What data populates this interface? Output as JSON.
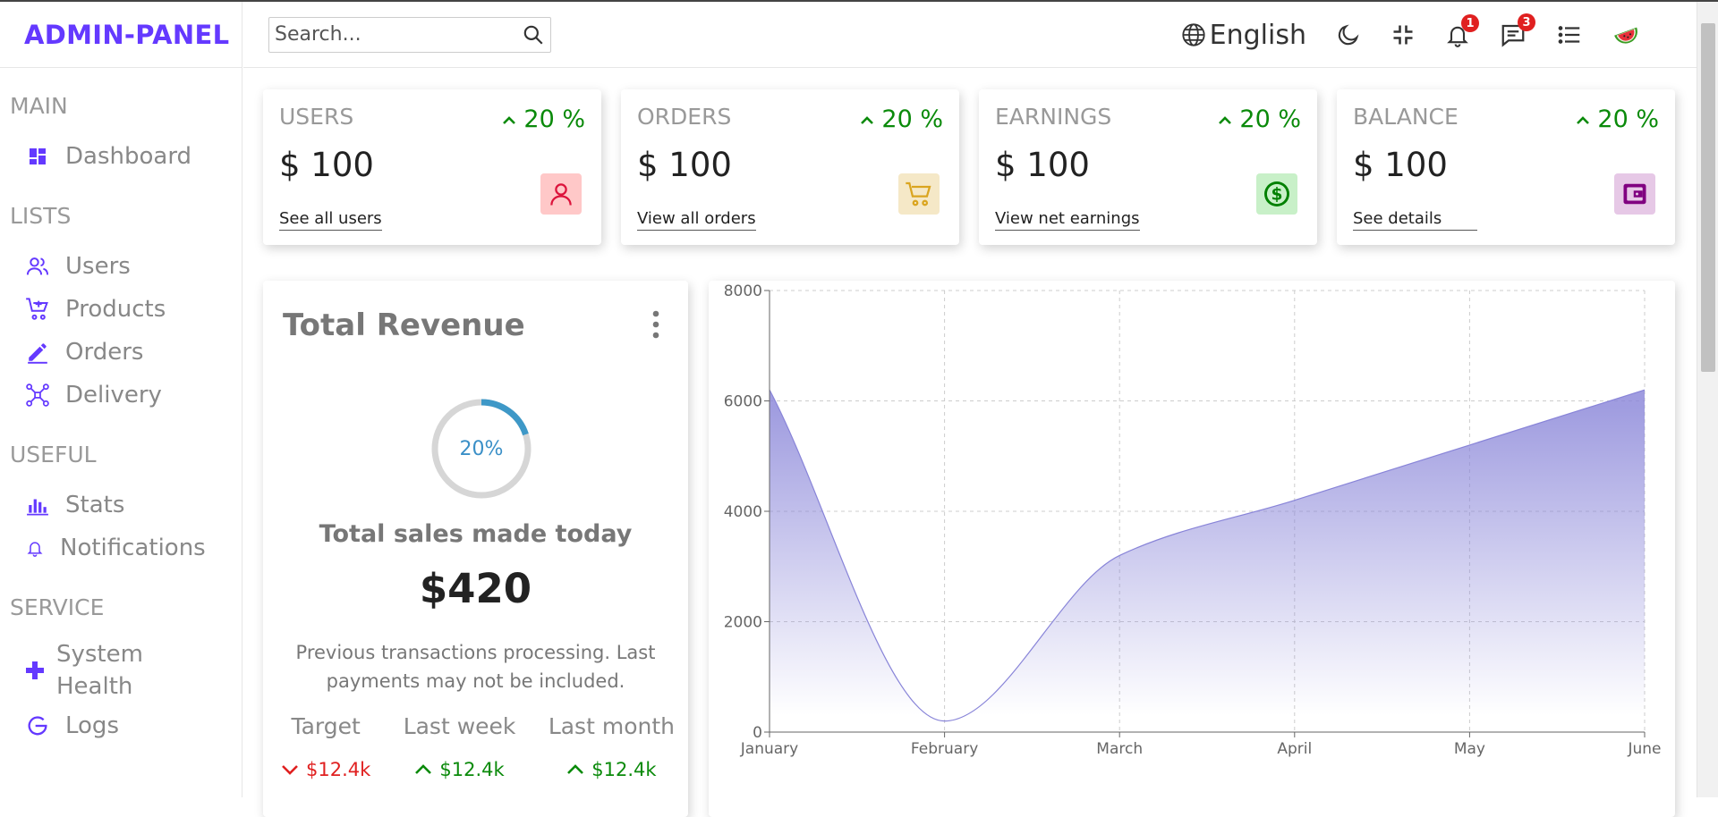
{
  "app": {
    "logo": "ADMIN-PANEL"
  },
  "sidebar": {
    "sections": [
      {
        "title": "MAIN",
        "items": [
          {
            "label": "Dashboard",
            "icon": "dashboard-icon"
          }
        ]
      },
      {
        "title": "LISTS",
        "items": [
          {
            "label": "Users",
            "icon": "users-icon"
          },
          {
            "label": "Products",
            "icon": "cart-icon"
          },
          {
            "label": "Orders",
            "icon": "pencil-icon"
          },
          {
            "label": "Delivery",
            "icon": "drone-icon"
          }
        ]
      },
      {
        "title": "USEFUL",
        "items": [
          {
            "label": "Stats",
            "icon": "stats-icon"
          },
          {
            "label": "Notifications",
            "icon": "bell-icon"
          }
        ]
      },
      {
        "title": "SERVICE",
        "items": [
          {
            "label": "System Health",
            "icon": "plus-icon"
          },
          {
            "label": "Logs",
            "icon": "logs-icon"
          }
        ]
      }
    ]
  },
  "topbar": {
    "search_placeholder": "Search...",
    "language": "English",
    "notifications_count": "1",
    "messages_count": "3"
  },
  "widgets": [
    {
      "title": "USERS",
      "counter": "$ 100",
      "link": "See all users",
      "percentage": "20 %",
      "icon": "person-icon",
      "icon_color": "#dc143c",
      "icon_bg": "#ffc8c8"
    },
    {
      "title": "ORDERS",
      "counter": "$ 100",
      "link": "View all orders",
      "percentage": "20 %",
      "icon": "shopping-cart-icon",
      "icon_color": "#daa520",
      "icon_bg": "#f5e8c7"
    },
    {
      "title": "EARNINGS",
      "counter": "$ 100",
      "link": "View net earnings",
      "percentage": "20 %",
      "icon": "dollar-icon",
      "icon_color": "#008000",
      "icon_bg": "#c8f0c8"
    },
    {
      "title": "BALANCE",
      "counter": "$ 100",
      "link": "See details",
      "percentage": "20 %",
      "icon": "wallet-icon",
      "icon_color": "#800080",
      "icon_bg": "#e6c8e6"
    }
  ],
  "featured": {
    "title": "Total Revenue",
    "progress": 20,
    "progress_label": "20%",
    "subtitle": "Total sales made today",
    "amount": "$420",
    "description": "Previous transactions processing. Last payments may not be included.",
    "summary": [
      {
        "title": "Target",
        "value": "$12.4k",
        "trend": "down"
      },
      {
        "title": "Last week",
        "value": "$12.4k",
        "trend": "up"
      },
      {
        "title": "Last month",
        "value": "$12.4k",
        "trend": "up"
      }
    ]
  },
  "chart_data": {
    "type": "area",
    "categories": [
      "January",
      "February",
      "March",
      "April",
      "May",
      "June"
    ],
    "values": [
      6200,
      200,
      3200,
      4200,
      5200,
      6200
    ],
    "ylim": [
      0,
      8000
    ],
    "yticks": [
      0,
      2000,
      4000,
      6000,
      8000
    ],
    "grid": true,
    "color": "#8884d8"
  }
}
